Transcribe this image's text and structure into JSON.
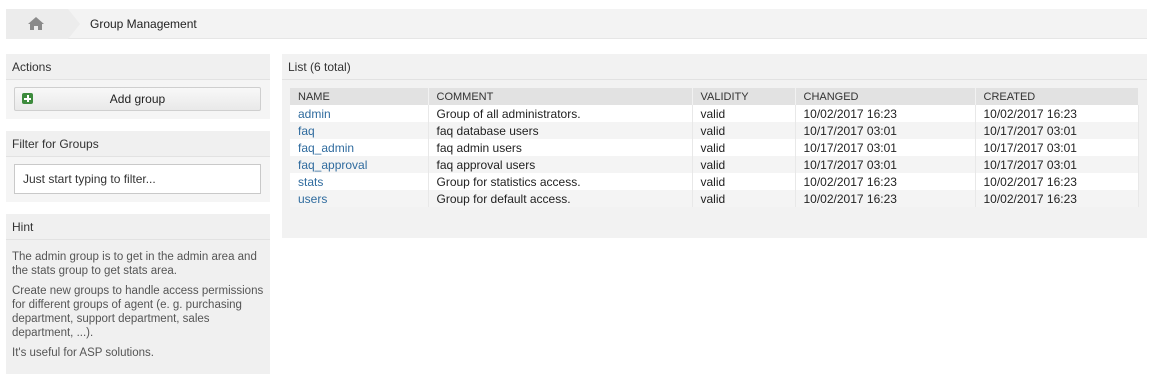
{
  "breadcrumb": {
    "home_icon": "home-icon",
    "title": "Group Management"
  },
  "actions": {
    "header": "Actions",
    "add_label": "Add group",
    "add_icon": "plus-square-icon"
  },
  "filter": {
    "header": "Filter for Groups",
    "placeholder": "Just start typing to filter..."
  },
  "hint": {
    "header": "Hint",
    "paragraphs": [
      "The admin group is to get in the admin area and the stats group to get stats area.",
      "Create new groups to handle access permissions for different groups of agent (e. g. purchasing department, support department, sales department, ...).",
      "It's useful for ASP solutions."
    ]
  },
  "list": {
    "header": "List (6 total)",
    "columns": [
      "NAME",
      "COMMENT",
      "VALIDITY",
      "CHANGED",
      "CREATED"
    ],
    "rows": [
      {
        "name": "admin",
        "comment": "Group of all administrators.",
        "validity": "valid",
        "changed": "10/02/2017 16:23",
        "created": "10/02/2017 16:23"
      },
      {
        "name": "faq",
        "comment": "faq database users",
        "validity": "valid",
        "changed": "10/17/2017 03:01",
        "created": "10/17/2017 03:01"
      },
      {
        "name": "faq_admin",
        "comment": "faq admin users",
        "validity": "valid",
        "changed": "10/17/2017 03:01",
        "created": "10/17/2017 03:01"
      },
      {
        "name": "faq_approval",
        "comment": "faq approval users",
        "validity": "valid",
        "changed": "10/17/2017 03:01",
        "created": "10/17/2017 03:01"
      },
      {
        "name": "stats",
        "comment": "Group for statistics access.",
        "validity": "valid",
        "changed": "10/02/2017 16:23",
        "created": "10/02/2017 16:23"
      },
      {
        "name": "users",
        "comment": "Group for default access.",
        "validity": "valid",
        "changed": "10/02/2017 16:23",
        "created": "10/02/2017 16:23"
      }
    ]
  },
  "colors": {
    "link": "#2f6b9e",
    "add_icon": "#3d8b3d"
  }
}
